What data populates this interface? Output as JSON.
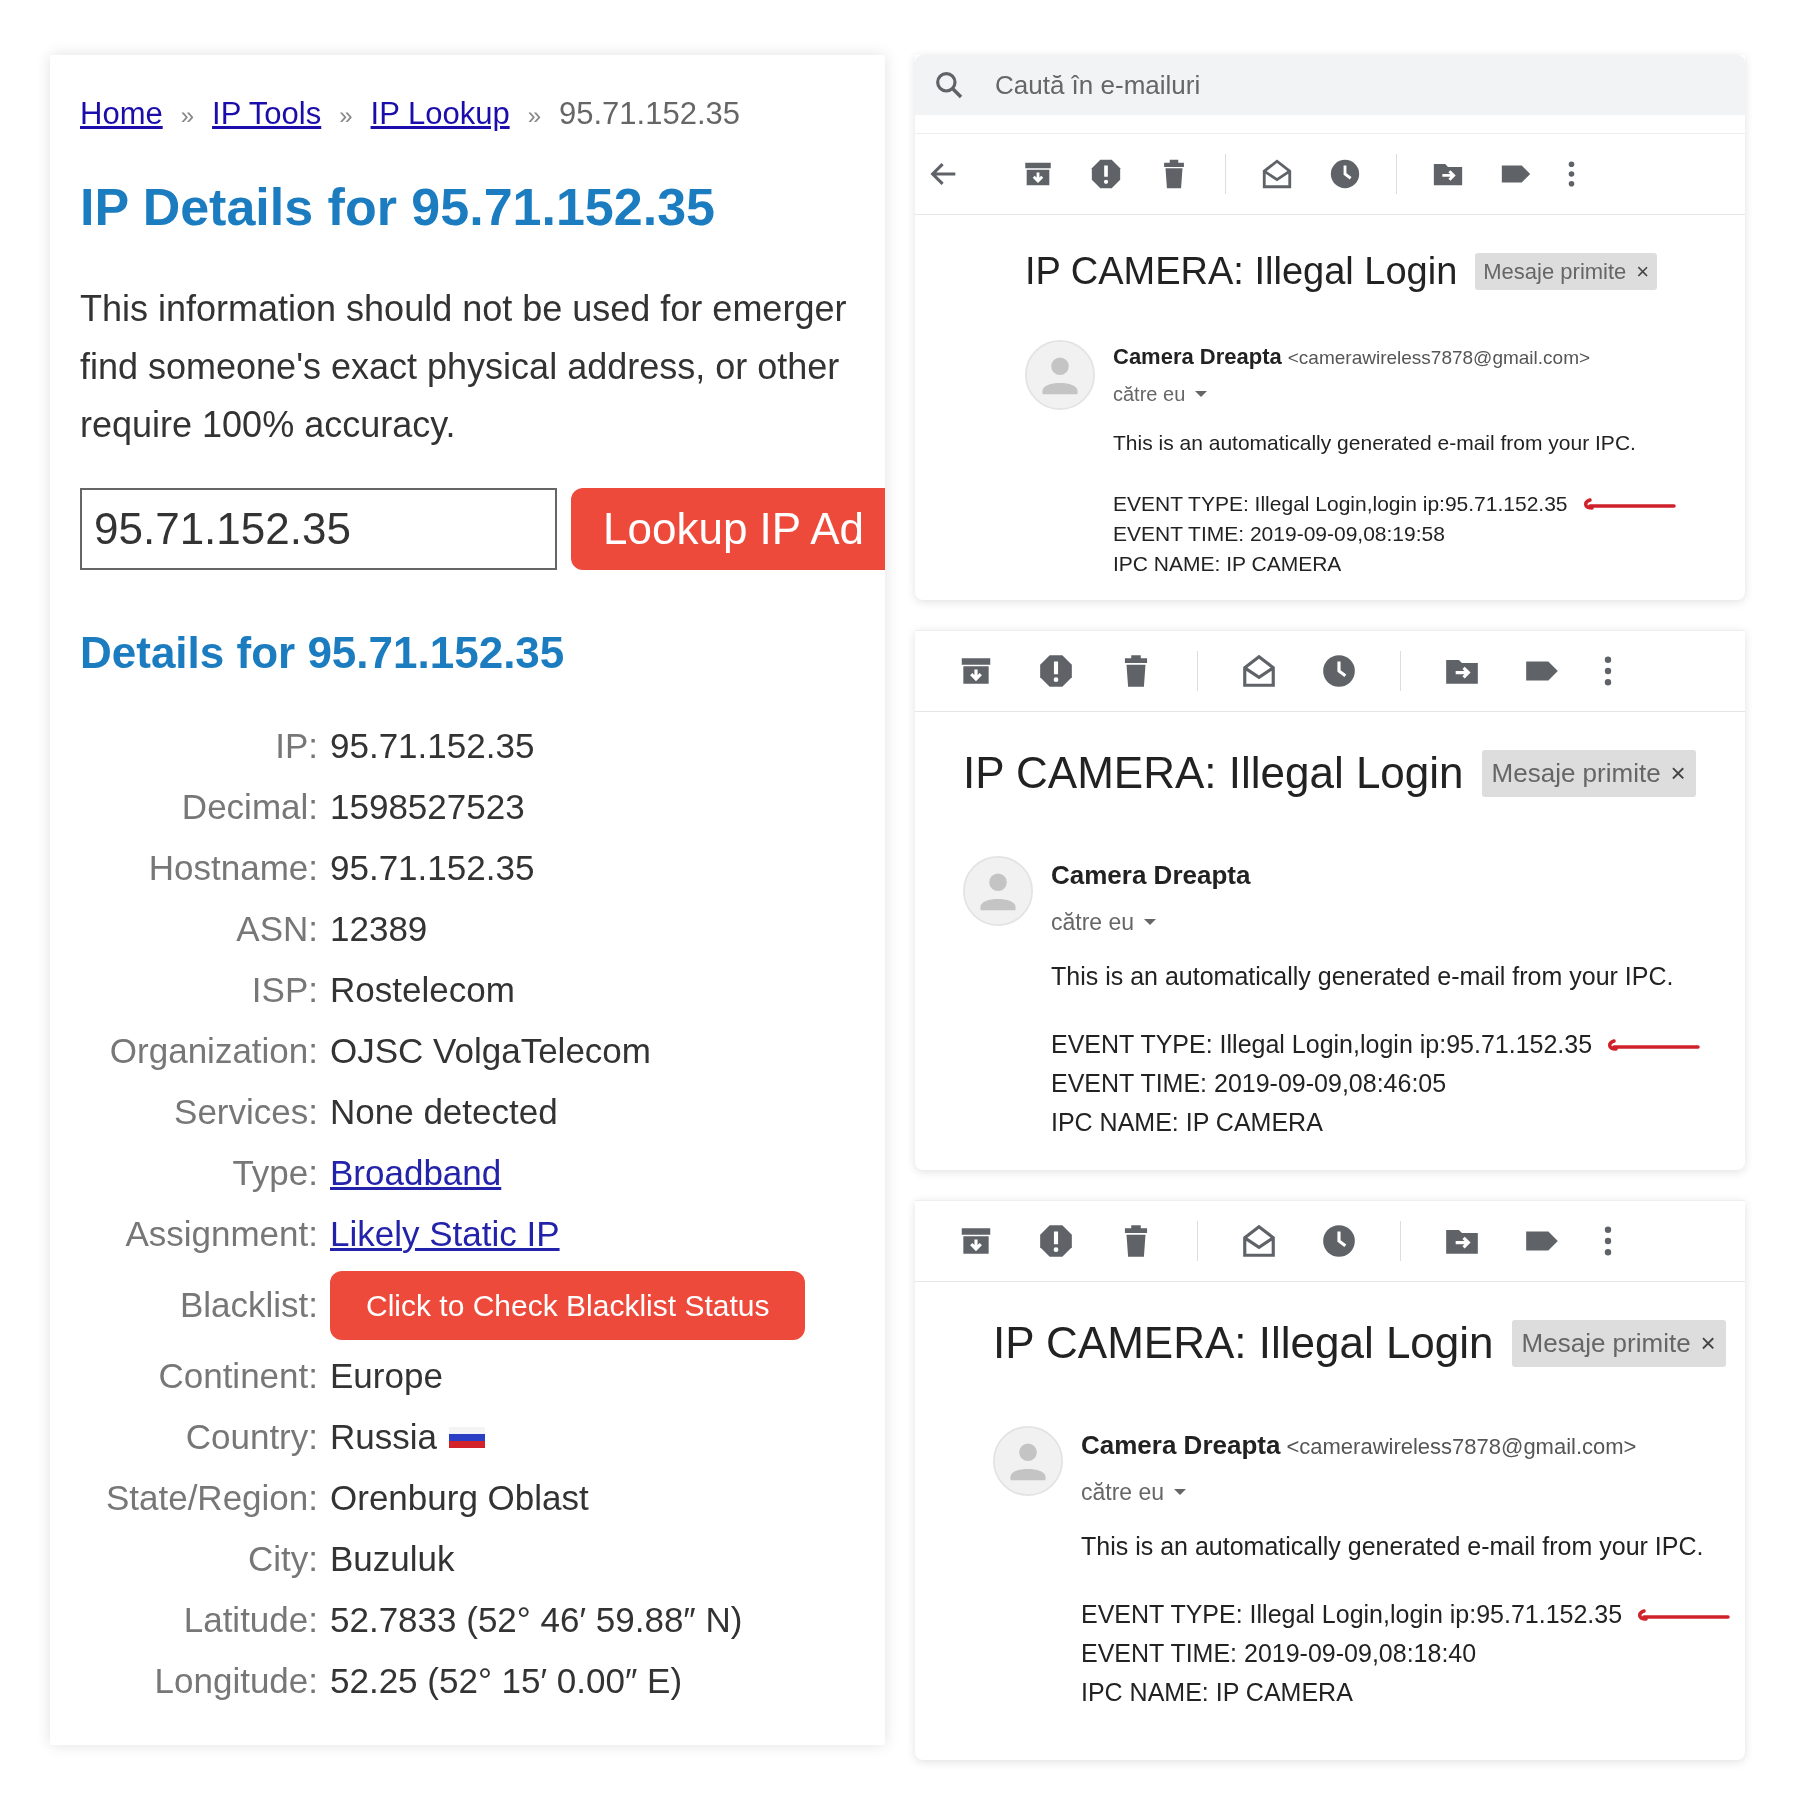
{
  "ip_page": {
    "breadcrumb": [
      {
        "kind": "link",
        "label": "Home"
      },
      {
        "kind": "separator",
        "label": "»"
      },
      {
        "kind": "link",
        "label": "IP Tools"
      },
      {
        "kind": "separator",
        "label": "»"
      },
      {
        "kind": "link",
        "label": "IP Lookup"
      },
      {
        "kind": "separator",
        "label": "»"
      },
      {
        "kind": "current",
        "label": "95.71.152.35"
      }
    ],
    "title": "IP Details for 95.71.152.35",
    "notice_lines": [
      "This information should not be used for emerger",
      "find someone's exact physical address, or other",
      "require 100% accuracy."
    ],
    "lookup": {
      "value": "95.71.152.35",
      "button": "Lookup IP Ad"
    },
    "details_title": "Details for 95.71.152.35",
    "details": [
      {
        "kind": "text",
        "label": "IP:",
        "value": "95.71.152.35"
      },
      {
        "kind": "text",
        "label": "Decimal:",
        "value": "1598527523"
      },
      {
        "kind": "text",
        "label": "Hostname:",
        "value": "95.71.152.35"
      },
      {
        "kind": "text",
        "label": "ASN:",
        "value": "12389"
      },
      {
        "kind": "text",
        "label": "ISP:",
        "value": "Rostelecom"
      },
      {
        "kind": "text",
        "label": "Organization:",
        "value": "OJSC VolgaTelecom"
      },
      {
        "kind": "text",
        "label": "Services:",
        "value": "None detected"
      },
      {
        "kind": "link",
        "label": "Type:",
        "value": "Broadband"
      },
      {
        "kind": "link",
        "label": "Assignment:",
        "value": "Likely Static IP"
      },
      {
        "kind": "button",
        "label": "Blacklist:",
        "value": "Click to Check Blacklist Status"
      },
      {
        "kind": "text",
        "label": "Continent:",
        "value": "Europe"
      },
      {
        "kind": "flag",
        "label": "Country:",
        "value": "Russia"
      },
      {
        "kind": "text",
        "label": "State/Region:",
        "value": "Orenburg Oblast"
      },
      {
        "kind": "text",
        "label": "City:",
        "value": "Buzuluk"
      },
      {
        "kind": "text",
        "label": "Latitude:",
        "value": "52.7833  (52° 46′ 59.88″ N)"
      },
      {
        "kind": "text",
        "label": "Longitude:",
        "value": "52.25  (52° 15′ 0.00″ E)"
      }
    ]
  },
  "mail": {
    "search": {
      "placeholder": "Caută în e-mailuri"
    },
    "messages": [
      {
        "back": true,
        "subject": "IP CAMERA: Illegal Login",
        "label": "Mesaje primite",
        "label_close": "×",
        "sender": "Camera Dreapta",
        "address": "<camerawireless7878@gmail.com>",
        "recipient": "către eu",
        "intro": "This is an automatically generated e-mail from your IPC.",
        "event_lines": [
          "EVENT TYPE: Illegal Login,login ip:95.71.152.35",
          "EVENT TIME: 2019-09-09,08:19:58",
          "IPC NAME: IP CAMERA"
        ],
        "annotated": true
      },
      {
        "back": false,
        "subject": "IP CAMERA: Illegal Login",
        "label": "Mesaje primite",
        "label_close": "×",
        "sender": "Camera Dreapta",
        "recipient": "către eu",
        "intro": "This is an automatically generated e-mail from your IPC.",
        "event_lines": [
          "EVENT TYPE: Illegal Login,login ip:95.71.152.35",
          "EVENT TIME: 2019-09-09,08:46:05",
          "IPC NAME: IP CAMERA"
        ],
        "annotated": true
      },
      {
        "back": false,
        "subject": "IP CAMERA: Illegal Login",
        "label": "Mesaje primite",
        "label_close": "×",
        "sender": "Camera Dreapta",
        "address": "<camerawireless7878@gmail.com>",
        "recipient": "către eu",
        "intro": "This is an automatically generated e-mail from your IPC.",
        "event_lines": [
          "EVENT TYPE: Illegal Login,login ip:95.71.152.35",
          "EVENT TIME: 2019-09-09,08:18:40",
          "IPC NAME: IP CAMERA"
        ],
        "annotated": true
      }
    ]
  }
}
